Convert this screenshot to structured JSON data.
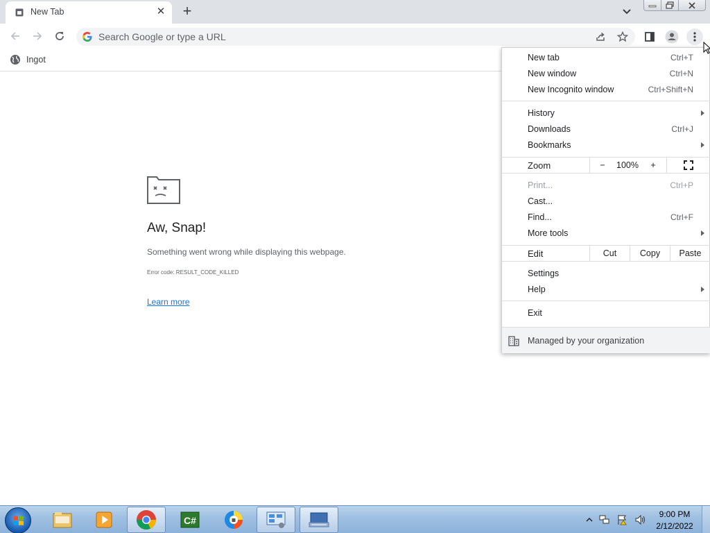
{
  "tab": {
    "title": "New Tab"
  },
  "omnibox": {
    "placeholder": "Search Google or type a URL"
  },
  "bookmarks": [
    {
      "label": "Ingot"
    }
  ],
  "error_page": {
    "title": "Aw, Snap!",
    "message": "Something went wrong while displaying this webpage.",
    "error_code": "Error code: RESULT_CODE_KILLED",
    "learn_more": "Learn more"
  },
  "menu": {
    "new_tab": {
      "label": "New tab",
      "shortcut": "Ctrl+T"
    },
    "new_window": {
      "label": "New window",
      "shortcut": "Ctrl+N"
    },
    "new_incognito": {
      "label": "New Incognito window",
      "shortcut": "Ctrl+Shift+N"
    },
    "history": {
      "label": "History"
    },
    "downloads": {
      "label": "Downloads",
      "shortcut": "Ctrl+J"
    },
    "bookmarks": {
      "label": "Bookmarks"
    },
    "zoom": {
      "label": "Zoom",
      "minus": "−",
      "value": "100%",
      "plus": "+"
    },
    "print": {
      "label": "Print...",
      "shortcut": "Ctrl+P"
    },
    "cast": {
      "label": "Cast..."
    },
    "find": {
      "label": "Find...",
      "shortcut": "Ctrl+F"
    },
    "more_tools": {
      "label": "More tools"
    },
    "edit": {
      "label": "Edit",
      "cut": "Cut",
      "copy": "Copy",
      "paste": "Paste"
    },
    "settings": {
      "label": "Settings"
    },
    "help": {
      "label": "Help"
    },
    "exit": {
      "label": "Exit"
    },
    "managed": {
      "label": "Managed by your organization"
    }
  },
  "taskbar": {
    "apps": [
      "windows-explorer",
      "media-player",
      "chrome",
      "csharp-app",
      "security-app",
      "control-panel",
      "keyboard-app"
    ],
    "clock": {
      "time": "9:00 PM",
      "date": "2/12/2022"
    }
  }
}
